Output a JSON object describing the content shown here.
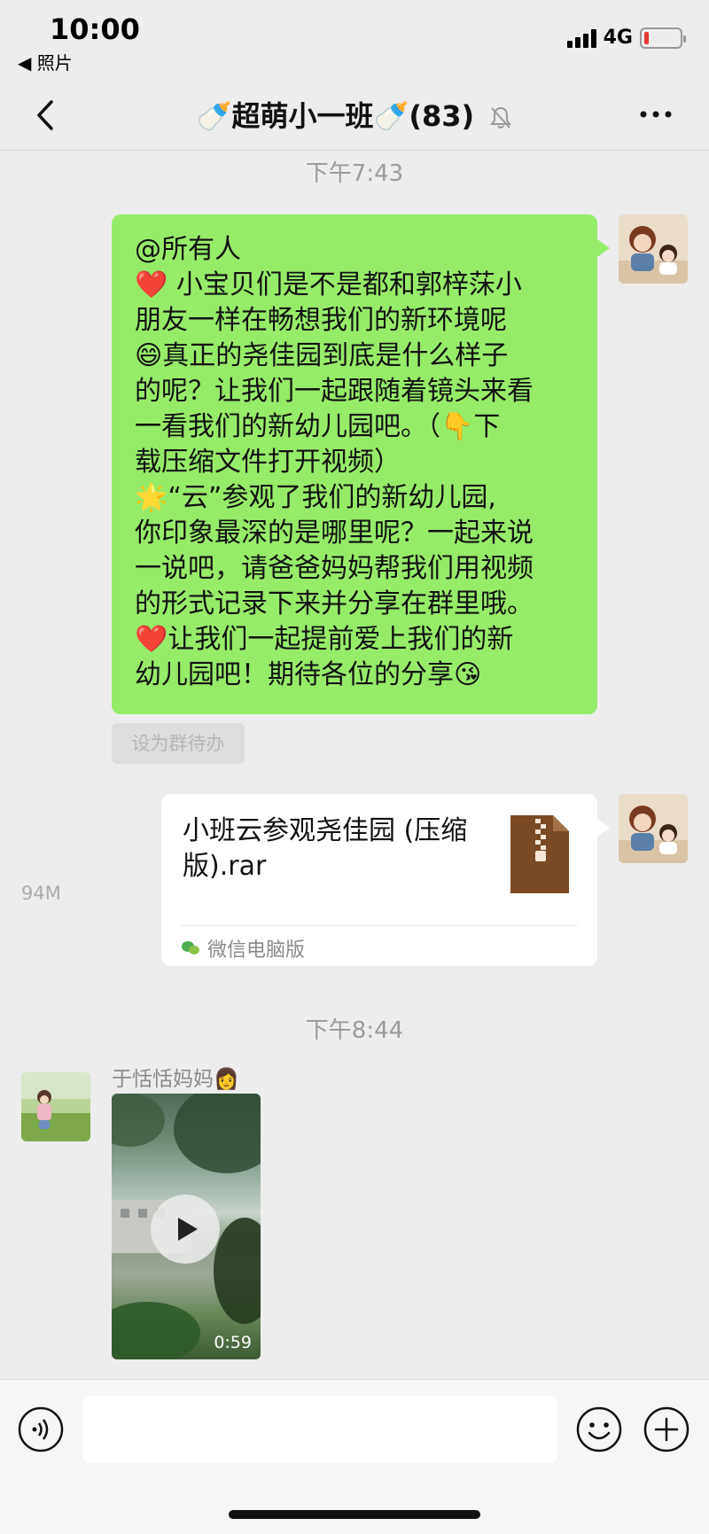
{
  "status_bar": {
    "time": "10:00",
    "back_label": "◀ 照片",
    "network": "4G"
  },
  "header": {
    "title": "🍼超萌小一班🍼(83)",
    "colors": {
      "accent_green": "#95ec69",
      "background": "#ededed"
    }
  },
  "messages": {
    "ts1": "下午7:43",
    "announcement_lines": [
      "@所有人",
      "❤️ 小宝贝们是不是都和郭梓莯小",
      "朋友一样在畅想我们的新环境呢",
      "😄真正的尧佳园到底是什么样子",
      "的呢？让我们一起跟随着镜头来看",
      "一看我们的新幼儿园吧。（👇下",
      "载压缩文件打开视频）",
      "🌟“云”参观了我们的新幼儿园,",
      "你印象最深的是哪里呢？一起来说",
      "一说吧，请爸爸妈妈帮我们用视频",
      "的形式记录下来并分享在群里哦。",
      "❤️让我们一起提前爱上我们的新",
      "幼儿园吧！期待各位的分享😘"
    ],
    "todo_button": "设为群待办",
    "file": {
      "name": "小班云参观尧佳园 (压缩版).rar",
      "size": "94M",
      "source": "微信电脑版"
    },
    "ts2": "下午8:44",
    "sender": "于恬恬妈妈👩",
    "video": {
      "duration": "0:59"
    }
  },
  "input_bar": {
    "placeholder": ""
  }
}
